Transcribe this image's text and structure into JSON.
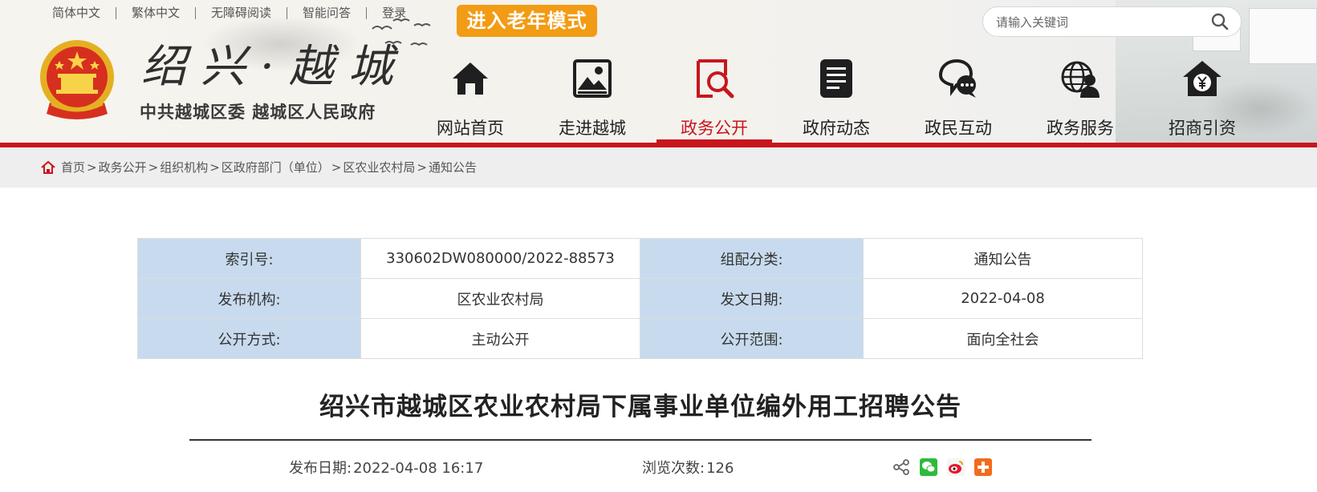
{
  "top_links": [
    "简体中文",
    "繁体中文",
    "无障碍阅读",
    "智能问答",
    "登录"
  ],
  "senior_mode": "进入老年模式",
  "search": {
    "placeholder": "请输入关键词"
  },
  "logo": {
    "title": "绍兴·越城",
    "subtitle": "中共越城区委 越城区人民政府"
  },
  "nav": [
    {
      "label": "网站首页",
      "icon": "home-icon"
    },
    {
      "label": "走进越城",
      "icon": "picture-icon"
    },
    {
      "label": "政务公开",
      "icon": "document-search-icon",
      "active": true
    },
    {
      "label": "政府动态",
      "icon": "news-icon"
    },
    {
      "label": "政民互动",
      "icon": "chat-icon"
    },
    {
      "label": "政务服务",
      "icon": "globe-person-icon"
    },
    {
      "label": "招商引资",
      "icon": "yuan-house-icon"
    }
  ],
  "breadcrumb": [
    "首页",
    "政务公开",
    "组织机构",
    "区政府部门（单位）",
    "区农业农村局",
    "通知公告"
  ],
  "info": {
    "index_label": "索引号:",
    "index_value": "330602DW080000/2022-88573",
    "category_label": "组配分类:",
    "category_value": "通知公告",
    "publisher_label": "发布机构:",
    "publisher_value": "区农业农村局",
    "doc_date_label": "发文日期:",
    "doc_date_value": "2022-04-08",
    "open_mode_label": "公开方式:",
    "open_mode_value": "主动公开",
    "scope_label": "公开范围:",
    "scope_value": "面向全社会"
  },
  "article": {
    "title": "绍兴市越城区农业农村局下属事业单位编外用工招聘公告",
    "publish_label": "发布日期:",
    "publish_value": "2022-04-08 16:17",
    "views_label": "浏览次数:",
    "views_value": "126"
  },
  "colors": {
    "brand_red": "#c8161d",
    "orange": "#f29b14",
    "table_key_bg": "#c8dbee"
  }
}
